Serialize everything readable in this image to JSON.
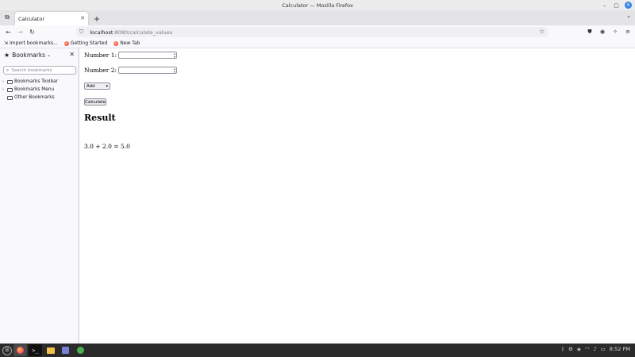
{
  "window": {
    "title": "Calculator — Mozilla Firefox"
  },
  "tabs": [
    {
      "label": "Calculator",
      "active": true
    }
  ],
  "navbar": {
    "url_host": "localhost",
    "url_path": ":8080/calculate_values"
  },
  "bookmarks_toolbar": {
    "items": [
      {
        "label": "Import bookmarks...",
        "icon": "import-icon"
      },
      {
        "label": "Getting Started",
        "icon": "firefox-icon"
      },
      {
        "label": "New Tab",
        "icon": "firefox-icon"
      }
    ]
  },
  "sidebar": {
    "title": "Bookmarks",
    "search_placeholder": "Search bookmarks",
    "tree": [
      {
        "label": "Bookmarks Toolbar",
        "expandable": true
      },
      {
        "label": "Bookmarks Menu",
        "expandable": true
      },
      {
        "label": "Other Bookmarks",
        "expandable": false
      }
    ]
  },
  "form": {
    "number1_label": "Number 1:",
    "number1_value": "",
    "number2_label": "Number 2:",
    "number2_value": "",
    "operation_selected": "Add",
    "calculate_label": "Calculate",
    "result_heading": "Result",
    "result_text": "3.0 + 2.0 = 5.0"
  },
  "taskbar": {
    "clock": "8:52 PM"
  },
  "colors": {
    "accent": "#3584e4",
    "taskbar_bg": "#2b2b2b"
  }
}
